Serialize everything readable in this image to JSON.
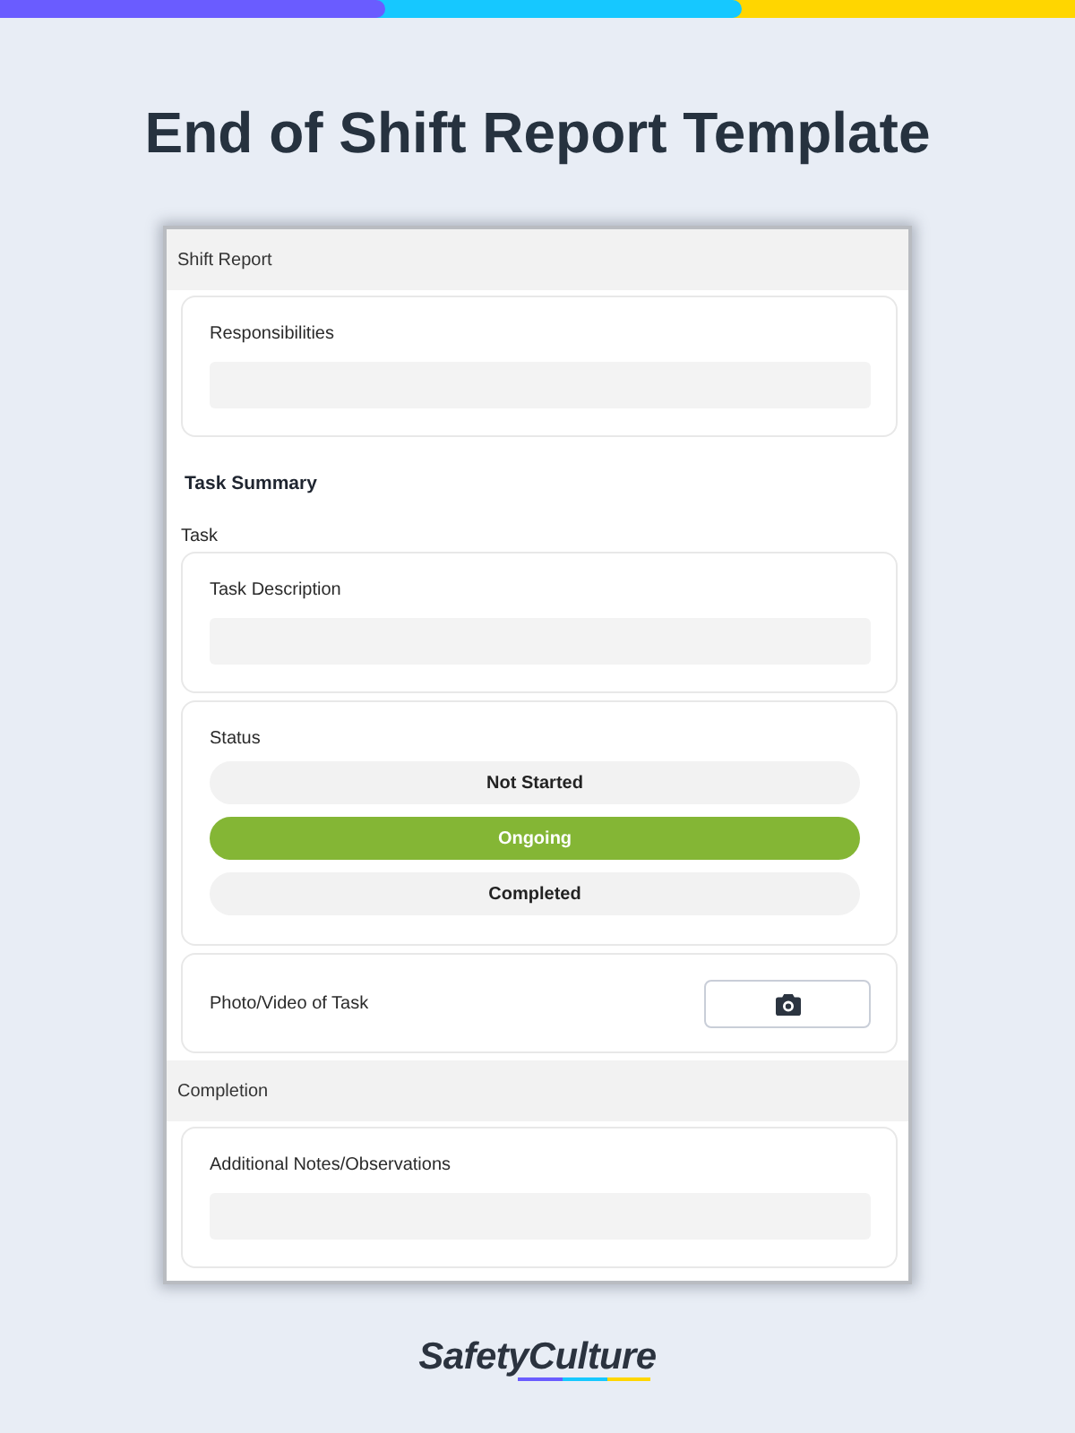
{
  "title": "End of Shift Report Template",
  "form": {
    "sections": [
      {
        "kind": "header",
        "label": "Shift Report"
      },
      {
        "kind": "text_question",
        "label": "Responsibilities"
      },
      {
        "kind": "heading",
        "label": "Task Summary"
      },
      {
        "kind": "subheading",
        "label": "Task"
      },
      {
        "kind": "text_question",
        "label": "Task Description"
      },
      {
        "kind": "choice_question",
        "label": "Status",
        "options": [
          {
            "label": "Not Started",
            "selected": false
          },
          {
            "label": "Ongoing",
            "selected": true
          },
          {
            "label": "Completed",
            "selected": false
          }
        ]
      },
      {
        "kind": "media_question",
        "label": "Photo/Video of Task"
      },
      {
        "kind": "header",
        "label": "Completion"
      },
      {
        "kind": "text_question",
        "label": "Additional Notes/Observations"
      }
    ]
  },
  "logo": {
    "text": "SafetyCulture"
  }
}
